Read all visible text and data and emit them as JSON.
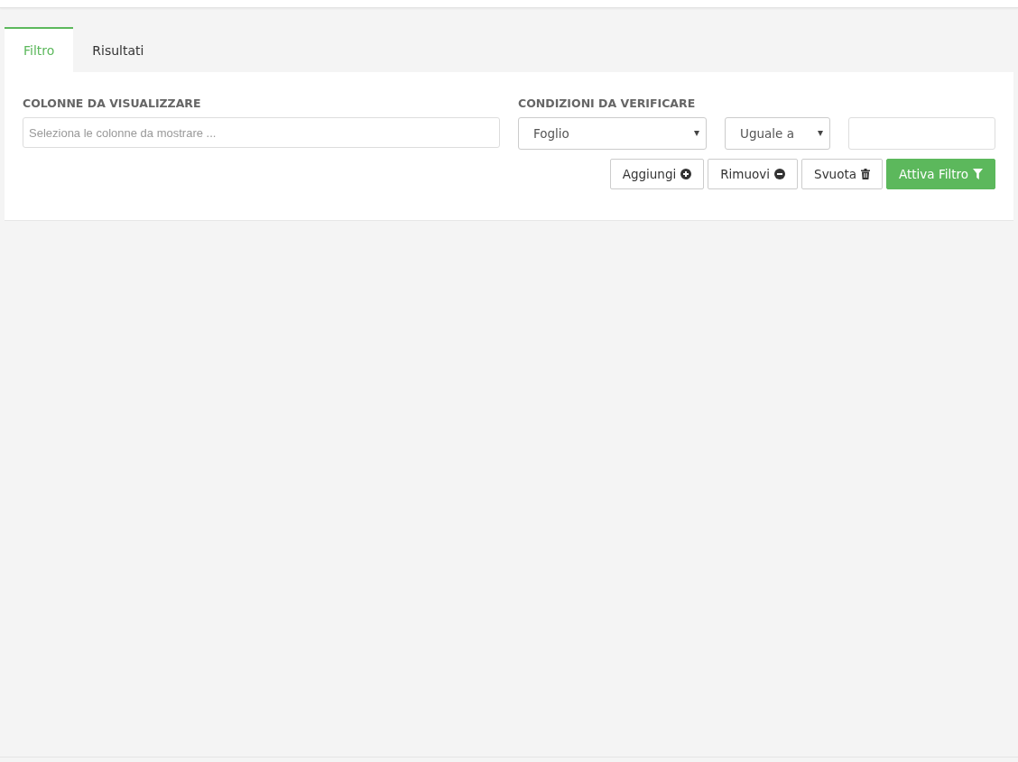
{
  "tabs": [
    {
      "label": "Filtro",
      "selected": true
    },
    {
      "label": "Risultati",
      "selected": false
    }
  ],
  "columns_section": {
    "heading": "COLONNE DA VISUALIZZARE",
    "field": {
      "placeholder": "Seleziona le colonne da mostrare ..."
    }
  },
  "conditions_section": {
    "heading": "CONDIZIONI DA VERIFICARE",
    "field_select": {
      "value": "Foglio"
    },
    "operator_select": {
      "value": "Uguale a"
    }
  },
  "buttons": [
    {
      "label": "Aggiungi",
      "kind": "add"
    },
    {
      "label": "Rimuovi",
      "kind": "remove"
    },
    {
      "label": "Svuota",
      "kind": "clear"
    },
    {
      "label": "Attiva Filtro",
      "kind": "apply"
    }
  ]
}
